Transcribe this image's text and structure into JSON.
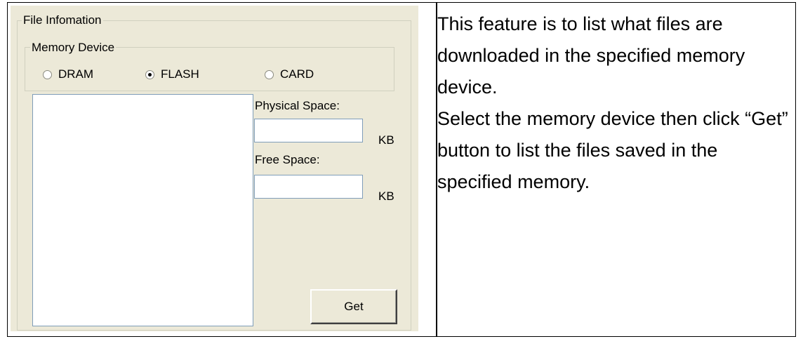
{
  "panel": {
    "file_group_title": "File Infomation",
    "memory_group_title": "Memory Device",
    "radios": [
      {
        "label": "DRAM",
        "selected": false
      },
      {
        "label": "FLASH",
        "selected": true
      },
      {
        "label": "CARD",
        "selected": false
      }
    ],
    "physical_space_label": "Physical Space:",
    "physical_space_value": "",
    "physical_space_unit": "KB",
    "free_space_label": "Free Space:",
    "free_space_value": "",
    "free_space_unit": "KB",
    "get_button_label": "Get"
  },
  "description": {
    "paragraph1": "This feature is to list what files are downloaded in the specified memory device.",
    "paragraph2": "Select the memory device then click “Get” button to list the files saved in the specified memory."
  }
}
